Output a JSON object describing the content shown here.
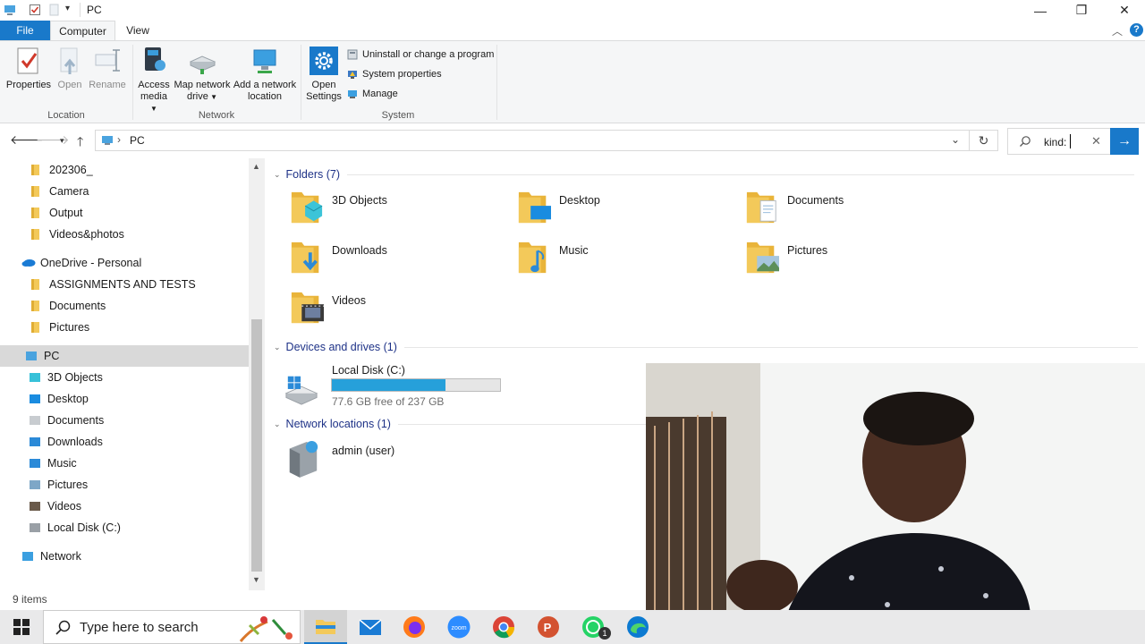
{
  "window": {
    "title": "PC",
    "controls": [
      "minimize",
      "restore",
      "close"
    ]
  },
  "ribbon_tabs": [
    {
      "label": "File"
    },
    {
      "label": "Computer"
    },
    {
      "label": "View"
    }
  ],
  "ribbon": {
    "location": {
      "group_label": "Location",
      "buttons": [
        {
          "label": "Properties",
          "icon": "properties-icon"
        },
        {
          "label": "Open",
          "icon": "open-icon"
        },
        {
          "label": "Rename",
          "icon": "rename-icon"
        }
      ]
    },
    "network": {
      "group_label": "Network",
      "buttons": [
        {
          "line1": "Access",
          "line2": "media",
          "icon": "access-media-icon"
        },
        {
          "line1": "Map network",
          "line2": "drive",
          "icon": "map-drive-icon"
        },
        {
          "line1": "Add a network",
          "line2": "location",
          "icon": "network-location-icon"
        }
      ]
    },
    "system": {
      "group_label": "System",
      "open_settings": {
        "line1": "Open",
        "line2": "Settings"
      },
      "small_buttons": [
        {
          "label": "Uninstall or change a program"
        },
        {
          "label": "System properties"
        },
        {
          "label": "Manage"
        }
      ]
    }
  },
  "address_bar": {
    "path": "PC",
    "search_value": "kind:"
  },
  "nav_pane": {
    "items": [
      {
        "label": "202306_",
        "icon": "folder-icon"
      },
      {
        "label": "Camera",
        "icon": "folder-icon"
      },
      {
        "label": "Output",
        "icon": "folder-icon"
      },
      {
        "label": "Videos&photos",
        "icon": "folder-icon"
      },
      {
        "label": "OneDrive - Personal",
        "icon": "onedrive-icon"
      },
      {
        "label": "ASSIGNMENTS AND TESTS",
        "icon": "folder-icon"
      },
      {
        "label": "Documents",
        "icon": "folder-icon"
      },
      {
        "label": "Pictures",
        "icon": "folder-icon"
      },
      {
        "label": "PC",
        "icon": "pc-icon",
        "selected": true
      },
      {
        "label": "3D Objects",
        "icon": "3d-objects-icon"
      },
      {
        "label": "Desktop",
        "icon": "desktop-icon"
      },
      {
        "label": "Documents",
        "icon": "documents-icon"
      },
      {
        "label": "Downloads",
        "icon": "downloads-icon"
      },
      {
        "label": "Music",
        "icon": "music-icon"
      },
      {
        "label": "Pictures",
        "icon": "pictures-icon"
      },
      {
        "label": "Videos",
        "icon": "videos-icon"
      },
      {
        "label": "Local Disk (C:)",
        "icon": "disk-icon"
      },
      {
        "label": "Network",
        "icon": "network-icon"
      }
    ]
  },
  "content": {
    "folders_header": "Folders (7)",
    "folders": [
      {
        "label": "3D Objects",
        "icon": "3d-objects-folder-icon"
      },
      {
        "label": "Desktop",
        "icon": "desktop-folder-icon"
      },
      {
        "label": "Documents",
        "icon": "documents-folder-icon"
      },
      {
        "label": "Downloads",
        "icon": "downloads-folder-icon"
      },
      {
        "label": "Music",
        "icon": "music-folder-icon"
      },
      {
        "label": "Pictures",
        "icon": "pictures-folder-icon"
      },
      {
        "label": "Videos",
        "icon": "videos-folder-icon"
      }
    ],
    "drives_header": "Devices and drives (1)",
    "drive": {
      "label": "Local Disk (C:)",
      "free_text": "77.6 GB free of 237 GB",
      "used_fraction": 0.673,
      "bar_color": "#26a0da"
    },
    "network_header": "Network locations (1)",
    "network_item": {
      "label": "admin (user)"
    }
  },
  "status_bar": {
    "text": "9 items"
  },
  "taskbar": {
    "search_placeholder": "Type here to search",
    "apps": [
      "file-explorer",
      "mail",
      "firefox",
      "zoom",
      "chrome",
      "powerpoint",
      "whatsapp",
      "edge"
    ],
    "whatsapp_badge": "1",
    "zoom_label": "zoom"
  },
  "colors": {
    "accent": "#1979ca",
    "folder": "#f3c95a",
    "section_header": "#1e3287"
  }
}
